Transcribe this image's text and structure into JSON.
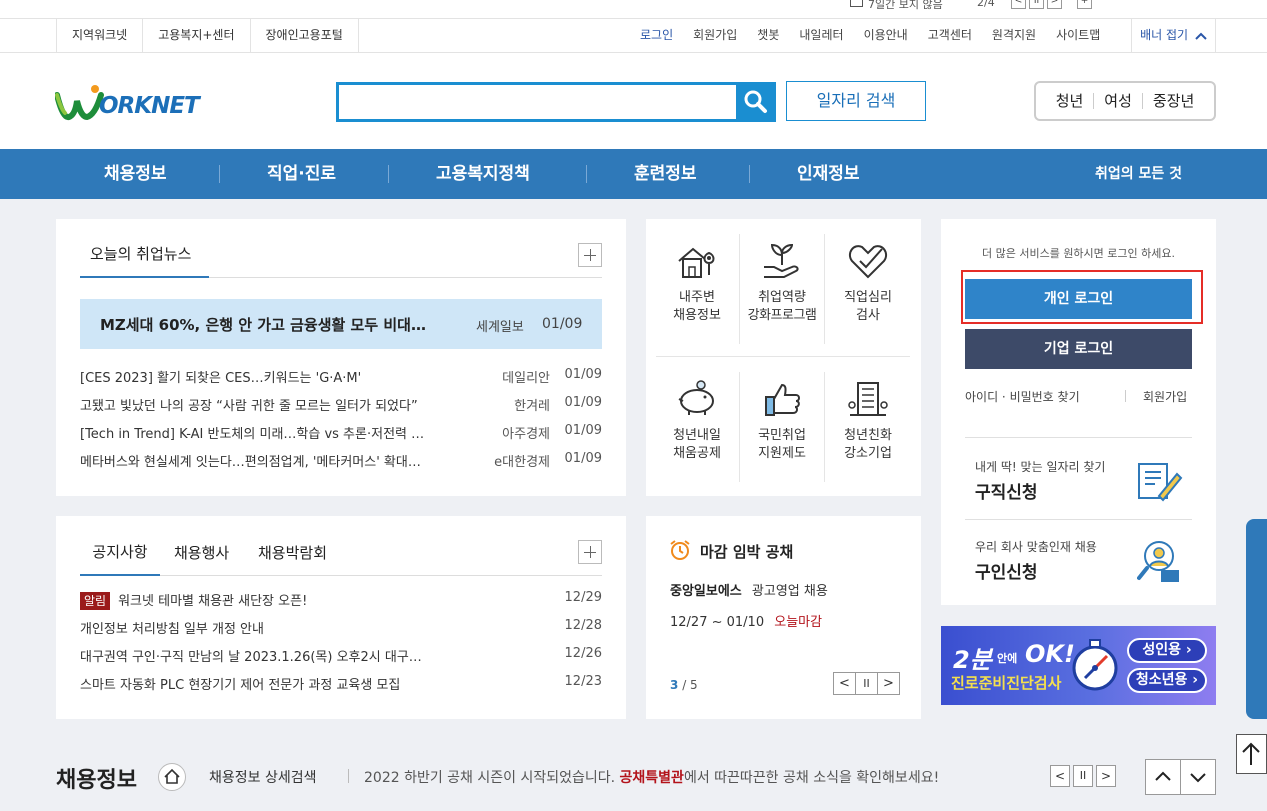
{
  "topstrip": {
    "checkbox_label": "7일간 보지 않음",
    "page": "2/4",
    "btn_prev": "<",
    "btn_pause": "II",
    "btn_next": ">",
    "btn_plus": "+"
  },
  "util_left": [
    "지역워크넷",
    "고용복지+센터",
    "장애인고용포털"
  ],
  "util_right": [
    "로그인",
    "회원가입",
    "챗봇",
    "내일레터",
    "이용안내",
    "고객센터",
    "원격지원",
    "사이트맵"
  ],
  "banner_toggle": "배너 접기",
  "header": {
    "logo_text": "ORKNET",
    "search_placeholder": "",
    "job_search": "일자리 검색",
    "age_groups": [
      "청년",
      "여성",
      "중장년"
    ]
  },
  "gnb": {
    "items": [
      "채용정보",
      "직업·진로",
      "고용복지정책",
      "훈련정보",
      "인재정보"
    ],
    "all": "취업의 모든 것"
  },
  "news": {
    "title": "오늘의 취업뉴스",
    "featured": {
      "title": "MZ세대 60%, 은행 안 가고 금융생활 모두 비대…",
      "source": "세계일보",
      "date": "01/09"
    },
    "items": [
      {
        "title": "[CES 2023] 활기 되찾은 CES…키워드는 'G·A·M'",
        "source": "데일리안",
        "date": "01/09"
      },
      {
        "title": "고됐고 빛났던 나의 공장 “사람 귀한 줄 모르는 일터가 되었다”",
        "source": "한겨레",
        "date": "01/09"
      },
      {
        "title": "[Tech in Trend] K-AI 반도체의 미래…학습 vs 추론·저전력 …",
        "source": "아주경제",
        "date": "01/09"
      },
      {
        "title": "메타버스와 현실세계 잇는다…편의점업계, '메타커머스' 확대…",
        "source": "e대한경제",
        "date": "01/09"
      }
    ]
  },
  "services": [
    {
      "line1": "내주변",
      "line2": "채용정보",
      "icon": "house-pin-icon"
    },
    {
      "line1": "취업역량",
      "line2": "강화프로그램",
      "icon": "sprout-hand-icon"
    },
    {
      "line1": "직업심리",
      "line2": "검사",
      "icon": "heart-check-icon"
    },
    {
      "line1": "청년내일",
      "line2": "채움공제",
      "icon": "piggy-bank-icon"
    },
    {
      "line1": "국민취업",
      "line2": "지원제도",
      "icon": "thumbs-up-icon"
    },
    {
      "line1": "청년친화",
      "line2": "강소기업",
      "icon": "building-icon"
    }
  ],
  "login": {
    "notice": "더 많은 서비스를 원하시면 로그인 하세요.",
    "personal": "개인 로그인",
    "company": "기업 로그인",
    "find": "아이디 · 비밀번호 찾기",
    "join": "회원가입",
    "apply_job_sub": "내게 딱! 맞는 일자리 찾기",
    "apply_job": "구직신청",
    "apply_talent_sub": "우리 회사 맞춤인재 채용",
    "apply_talent": "구인신청"
  },
  "notice": {
    "tabs": [
      "공지사항",
      "채용행사",
      "채용박람회"
    ],
    "items": [
      {
        "badge": "알림",
        "title": "워크넷 테마별 채용관 새단장 오픈!",
        "date": "12/29"
      },
      {
        "badge": "",
        "title": "개인정보 처리방침 일부 개정 안내",
        "date": "12/28"
      },
      {
        "badge": "",
        "title": "대구권역 구인·구직 만남의 날 2023.1.26(목) 오후2시 대구…",
        "date": "12/26"
      },
      {
        "badge": "",
        "title": "스마트 자동화 PLC 현장기기 제어 전문가 과정 교육생 모집",
        "date": "12/23"
      }
    ]
  },
  "deadline": {
    "title": "마감 임박 공채",
    "company": "중앙일보에스",
    "position": "광고영업 채용",
    "period": "12/27 ~ 01/10",
    "status": "오늘마감",
    "page_current": "3",
    "page_total": "/ 5"
  },
  "banner_ad": {
    "headline_a": "2분",
    "headline_b": "안에",
    "headline_c": "OK!",
    "subline": "진로준비진단검사",
    "adult": "성인용 ›",
    "youth": "청소년용 ›"
  },
  "bottom": {
    "title": "채용정보",
    "detail_search": "채용정보 상세검색",
    "ticker_a": "2022 하반기 공채 시즌이 시작되었습니다. ",
    "ticker_highlight": "공채특별관",
    "ticker_b": "에서 따끈따끈한 공채 소식을 확인해보세요!"
  },
  "colors": {
    "primary": "#2f79b9",
    "search": "#1a8ed1",
    "company_btn": "#3d4a68",
    "highlight": "#e52d27",
    "news_featured_bg": "#cfe6f7"
  }
}
